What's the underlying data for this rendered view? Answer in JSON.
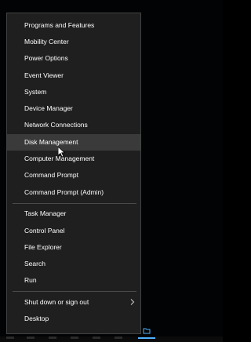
{
  "menu": {
    "group1": [
      {
        "label": "Programs and Features"
      },
      {
        "label": "Mobility Center"
      },
      {
        "label": "Power Options"
      },
      {
        "label": "Event Viewer"
      },
      {
        "label": "System"
      },
      {
        "label": "Device Manager"
      },
      {
        "label": "Network Connections"
      },
      {
        "label": "Disk Management"
      },
      {
        "label": "Computer Management"
      },
      {
        "label": "Command Prompt"
      },
      {
        "label": "Command Prompt (Admin)"
      }
    ],
    "group2": [
      {
        "label": "Task Manager"
      },
      {
        "label": "Control Panel"
      },
      {
        "label": "File Explorer"
      },
      {
        "label": "Search"
      },
      {
        "label": "Run"
      }
    ],
    "group3": [
      {
        "label": "Shut down or sign out",
        "submenu_icon": "chevron-right-icon"
      },
      {
        "label": "Desktop"
      }
    ],
    "highlighted_item": "Disk Management"
  },
  "colors": {
    "menu_background": "#1f1f1f",
    "highlight": "#3a3a3a",
    "text": "#ffffff",
    "taskbar_accent": "#4fb0ff"
  }
}
